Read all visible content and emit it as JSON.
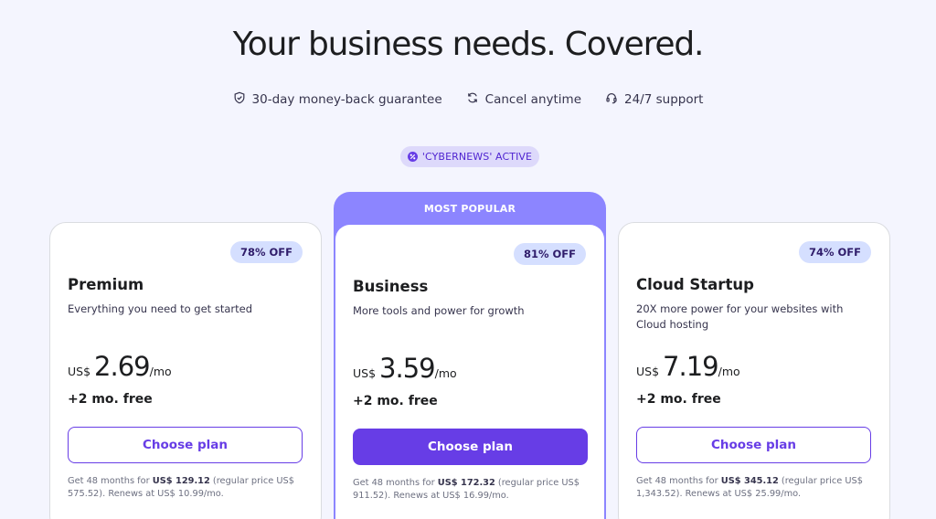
{
  "header": {
    "title": "Your business needs. Covered."
  },
  "features": [
    {
      "icon": "shield-check-icon",
      "label": "30-day money-back guarantee"
    },
    {
      "icon": "refresh-icon",
      "label": "Cancel anytime"
    },
    {
      "icon": "headset-icon",
      "label": "24/7 support"
    }
  ],
  "coupon": {
    "icon": "discount-badge-icon",
    "label": "'CYBERNEWS' ACTIVE"
  },
  "plans": [
    {
      "badge": "78% OFF",
      "name": "Premium",
      "description": "Everything you need to get started",
      "currency": "US$",
      "price": "2.69",
      "period": "/mo",
      "bonus": "+2 mo. free",
      "cta": "Choose plan",
      "fine_prefix": "Get 48 months for ",
      "fine_total": "US$ 129.12",
      "fine_suffix": " (regular price US$ 575.52). Renews at US$ 10.99/mo."
    },
    {
      "ribbon": "MOST POPULAR",
      "badge": "81% OFF",
      "name": "Business",
      "description": "More tools and power for growth",
      "currency": "US$",
      "price": "3.59",
      "period": "/mo",
      "bonus": "+2 mo. free",
      "cta": "Choose plan",
      "fine_prefix": "Get 48 months for ",
      "fine_total": "US$ 172.32",
      "fine_suffix": " (regular price US$ 911.52). Renews at US$ 16.99/mo."
    },
    {
      "badge": "74% OFF",
      "name": "Cloud Startup",
      "description": "20X more power for your websites with Cloud hosting",
      "currency": "US$",
      "price": "7.19",
      "period": "/mo",
      "bonus": "+2 mo. free",
      "cta": "Choose plan",
      "fine_prefix": "Get 48 months for ",
      "fine_total": "US$ 345.12",
      "fine_suffix": " (regular price US$ 1,343.52). Renews at US$ 25.99/mo."
    }
  ],
  "colors": {
    "accent": "#673de6",
    "popular": "#8c85ff",
    "badge_bg": "#d5dfff",
    "background": "#f4f5fe"
  }
}
